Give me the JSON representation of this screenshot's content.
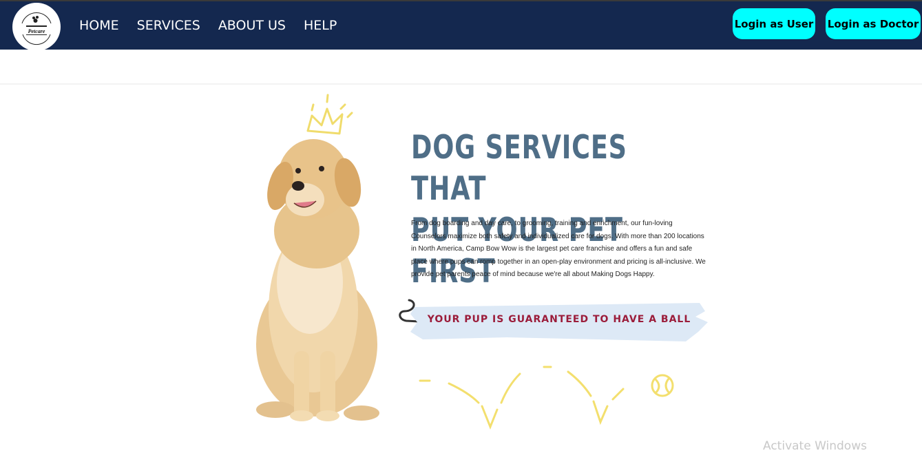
{
  "nav": {
    "logo_text": "Petcare",
    "links": [
      "HOME",
      "SERVICES",
      "ABOUT US",
      "HELP"
    ],
    "login_user": "Login as User",
    "login_doctor": "Login as Doctor"
  },
  "hero": {
    "heading_line1": "DOG SERVICES THAT",
    "heading_line2": "PUT YOUR PET FIRST",
    "body": "From dog boarding and day care, to grooming, training and enrichment, our fun-loving Counselors maximize both safety and individualized care for dogs. With more than 200 locations in North America, Camp Bow Wow is the largest pet care franchise and offers a fun and safe place where pups can romp together in an open-play environment and pricing is all-inclusive. We provide pet parents peace of mind because we're all about Making Dogs Happy.",
    "banner": "YOUR PUP IS GUARANTEED TO HAVE A BALL"
  },
  "watermark": "Activate Windows",
  "colors": {
    "navbar_bg": "#14284f",
    "button_bg": "#00ffff",
    "heading": "#4f6e87",
    "banner_text": "#9b1c3a",
    "banner_bg": "#dde9f6",
    "accent_yellow": "#f3df6e"
  }
}
